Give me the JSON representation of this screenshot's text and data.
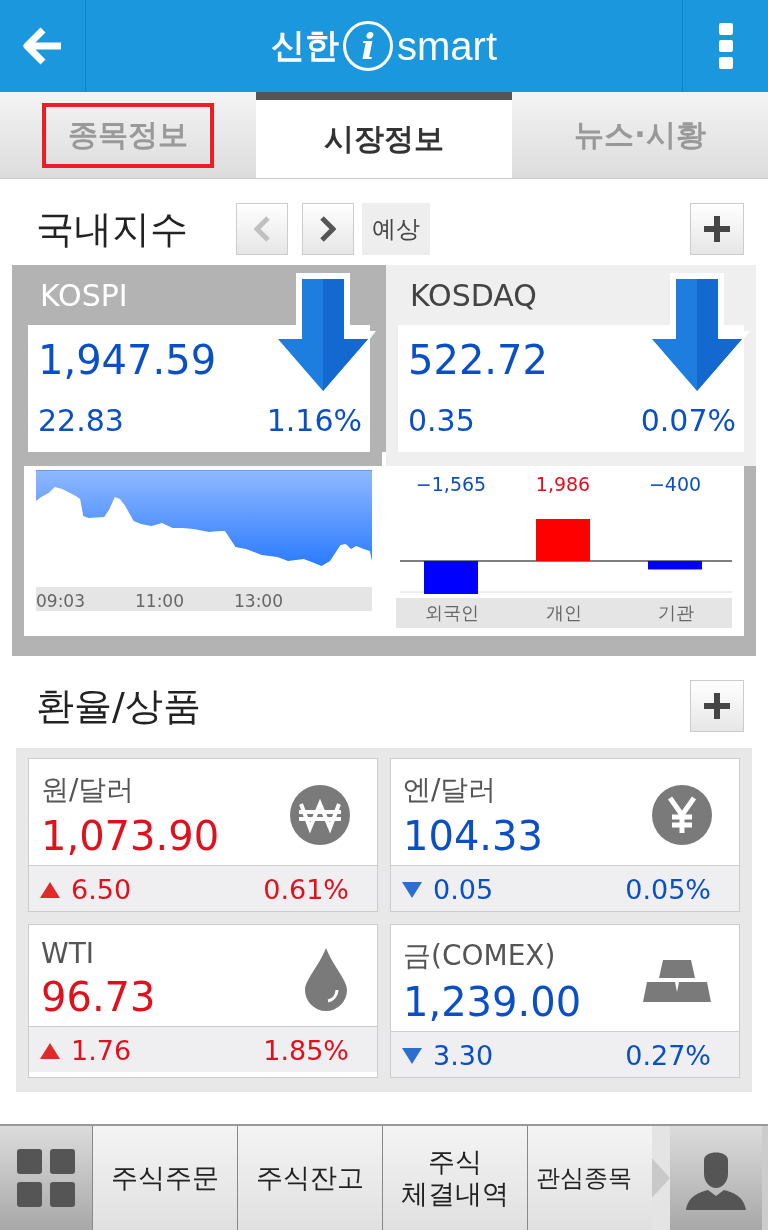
{
  "header": {
    "logo": {
      "left": "신한",
      "mark": "i",
      "right": "smart"
    }
  },
  "tabs": [
    {
      "label": "종목정보",
      "selected": false,
      "highlighted": true
    },
    {
      "label": "시장정보",
      "selected": true,
      "highlighted": false
    },
    {
      "label": "뉴스·시황",
      "selected": false,
      "highlighted": false
    }
  ],
  "domestic": {
    "title": "국내지수",
    "prev_disabled": true,
    "next_disabled": false,
    "forecast": "예상",
    "indices": [
      {
        "name": "KOSPI",
        "selected": true,
        "rising": false,
        "value": "1,947.59",
        "change": "22.83",
        "percent": "1.16%"
      },
      {
        "name": "KOSDAQ",
        "selected": false,
        "rising": false,
        "value": "522.72",
        "change": "0.35",
        "percent": "0.07%"
      }
    ],
    "intraday": {
      "times": [
        "09:03",
        "11:00",
        "13:00"
      ]
    },
    "investors": {
      "chart_data": {
        "type": "bar",
        "categories": [
          "외국인",
          "개인",
          "기관"
        ],
        "values": [
          -1565,
          1986,
          -400
        ],
        "data_labels": true,
        "value_labels": [
          "−1,565",
          "1,986",
          "−400"
        ]
      }
    }
  },
  "fx": {
    "title": "환율/상품",
    "items": [
      {
        "name": "원/달러",
        "kind": "won",
        "rising": true,
        "value": "1,073.90",
        "change": "6.50",
        "percent": "0.61%"
      },
      {
        "name": "엔/달러",
        "kind": "yen",
        "rising": false,
        "value": "104.33",
        "change": "0.05",
        "percent": "0.05%"
      },
      {
        "name": "WTI",
        "kind": "oil",
        "rising": true,
        "value": "96.73",
        "change": "1.76",
        "percent": "1.85%"
      },
      {
        "name": "금(COMEX)",
        "kind": "metal",
        "rising": false,
        "value": "1,239.00",
        "change": "3.30",
        "percent": "0.27%"
      }
    ]
  },
  "bottom_bar": {
    "items": [
      {
        "lines": [
          "주식주문"
        ]
      },
      {
        "lines": [
          "주식잔고"
        ]
      },
      {
        "lines": [
          "주식",
          "체결내역"
        ]
      },
      {
        "lines": [
          "관심종목"
        ]
      }
    ]
  }
}
